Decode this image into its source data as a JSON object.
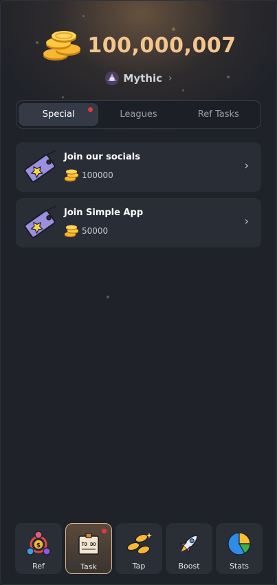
{
  "header": {
    "balance": "100,000,007",
    "balance_icon": "coin-stack-icon",
    "league_label": "Mythic",
    "league_icon": "mythic-league-icon"
  },
  "tabs": [
    {
      "label": "Special",
      "active": true,
      "has_notification": true
    },
    {
      "label": "Leagues",
      "active": false
    },
    {
      "label": "Ref Tasks",
      "active": false
    }
  ],
  "tasks": [
    {
      "title": "Join our socials",
      "reward": "100000",
      "icon": "ticket-star-icon"
    },
    {
      "title": "Join Simple App",
      "reward": "50000",
      "icon": "ticket-star-icon"
    }
  ],
  "nav": [
    {
      "label": "Ref",
      "icon": "referral-people-icon"
    },
    {
      "label": "Task",
      "icon": "todo-note-icon",
      "active": true,
      "has_notification": true
    },
    {
      "label": "Tap",
      "icon": "coins-tap-icon"
    },
    {
      "label": "Boost",
      "icon": "rocket-icon"
    },
    {
      "label": "Stats",
      "icon": "pie-chart-icon"
    }
  ],
  "colors": {
    "background": "#1f2229",
    "balance": "#f5c58f",
    "notification_dot": "#e23a3a",
    "active_nav_border": "#d8b894"
  }
}
